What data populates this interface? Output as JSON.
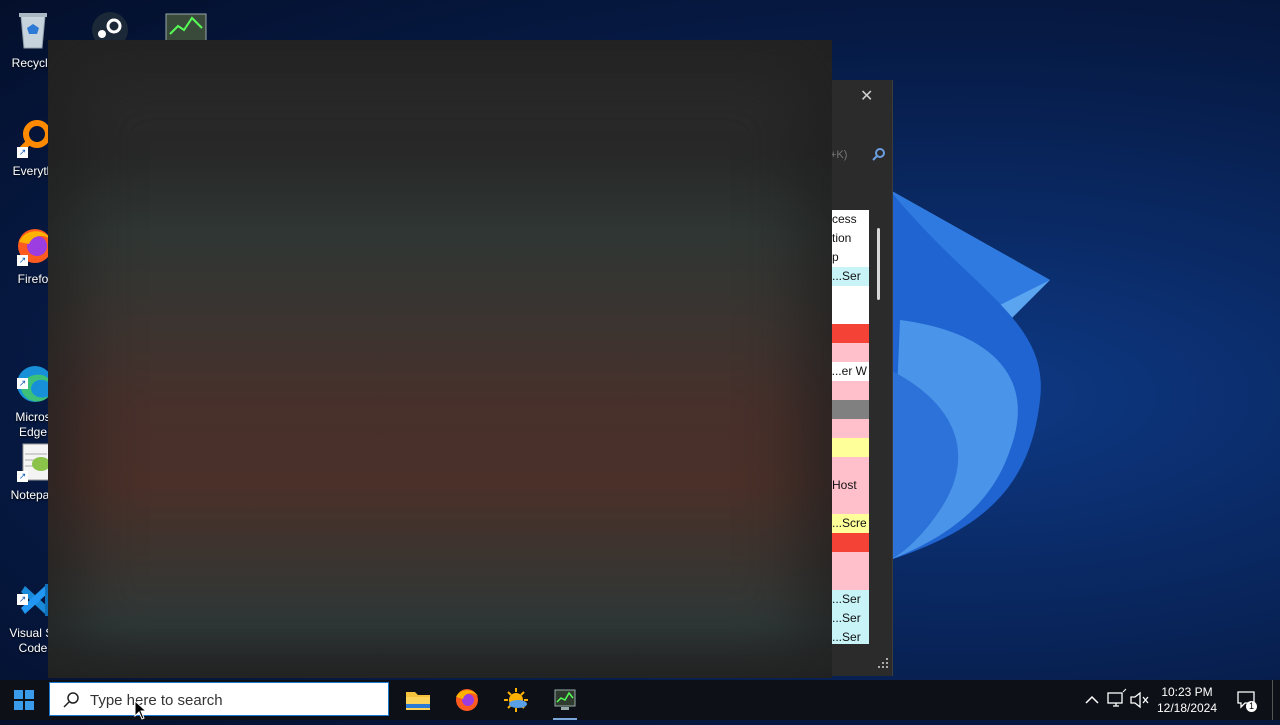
{
  "desktop": {
    "icons": [
      {
        "label": "Recycle",
        "icon": "recycle-bin-icon"
      },
      {
        "label": "Everyth",
        "icon": "everything-search-icon"
      },
      {
        "label": "Firefo",
        "icon": "firefox-icon"
      },
      {
        "label": "Micros\nEdge",
        "icon": "edge-icon"
      },
      {
        "label": "Notepac",
        "icon": "notepadpp-icon"
      },
      {
        "label": "Visual St\nCode",
        "icon": "vscode-icon"
      }
    ],
    "top_icons": [
      "steam-icon",
      "system-monitor-icon"
    ]
  },
  "background_window": {
    "close_glyph": "✕",
    "search_hint": "+K)",
    "rows": [
      {
        "text": "cess",
        "color": "#ffffff"
      },
      {
        "text": "tion",
        "color": "#ffffff"
      },
      {
        "text": "p",
        "color": "#ffffff"
      },
      {
        "text": "Ser...",
        "color": "#c8f4f8"
      },
      {
        "text": "",
        "color": "#ffffff"
      },
      {
        "text": "",
        "color": "#ffffff"
      },
      {
        "text": "",
        "color": "#f44336"
      },
      {
        "text": "",
        "color": "#ffc0cb"
      },
      {
        "text": "er W...",
        "color": "#ffffff"
      },
      {
        "text": "",
        "color": "#ffc0cb"
      },
      {
        "text": "",
        "color": "#808080"
      },
      {
        "text": "",
        "color": "#ffc0cb"
      },
      {
        "text": "",
        "color": "#ffff99"
      },
      {
        "text": "",
        "color": "#ffc0cb"
      },
      {
        "text": "Host",
        "color": "#ffc0cb"
      },
      {
        "text": "",
        "color": "#ffc0cb"
      },
      {
        "text": "Scre...",
        "color": "#ffff99"
      },
      {
        "text": "",
        "color": "#f44336"
      },
      {
        "text": "",
        "color": "#ffc0cb"
      },
      {
        "text": "",
        "color": "#ffc0cb"
      },
      {
        "text": "Ser...",
        "color": "#c8f4f8"
      },
      {
        "text": "Ser...",
        "color": "#c8f4f8"
      },
      {
        "text": "Ser...",
        "color": "#c8f4f8"
      }
    ]
  },
  "taskbar": {
    "search_placeholder": "Type here to search",
    "apps": [
      "file-explorer-icon",
      "firefox-icon",
      "weather-app-icon",
      "system-monitor-icon"
    ],
    "clock": {
      "time": "10:23 PM",
      "date": "12/18/2024"
    },
    "notification_count": "1"
  },
  "colors": {
    "accent": "#1e78d0",
    "taskbar": "#0d1117"
  }
}
